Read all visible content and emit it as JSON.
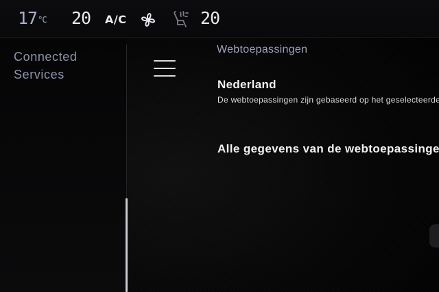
{
  "climate": {
    "outside_temp": "17",
    "outside_unit": "°C",
    "driver_temp": "20",
    "ac_label": "A/C",
    "passenger_temp": "20",
    "icons": [
      "fan-icon",
      "seat-airflow-icon"
    ]
  },
  "sidebar": {
    "title": "Connected Services"
  },
  "main": {
    "page_title": "Webtoepassingen",
    "section_title": "Nederland",
    "section_description": "De webtoepassingen zijn gebaseerd op het geselecteerde land",
    "all_data_label": "Alle gegevens van de webtoepassingen"
  },
  "colors": {
    "background": "#000000",
    "text_primary": "#f3f3f6",
    "text_secondary": "#9da2ba"
  }
}
